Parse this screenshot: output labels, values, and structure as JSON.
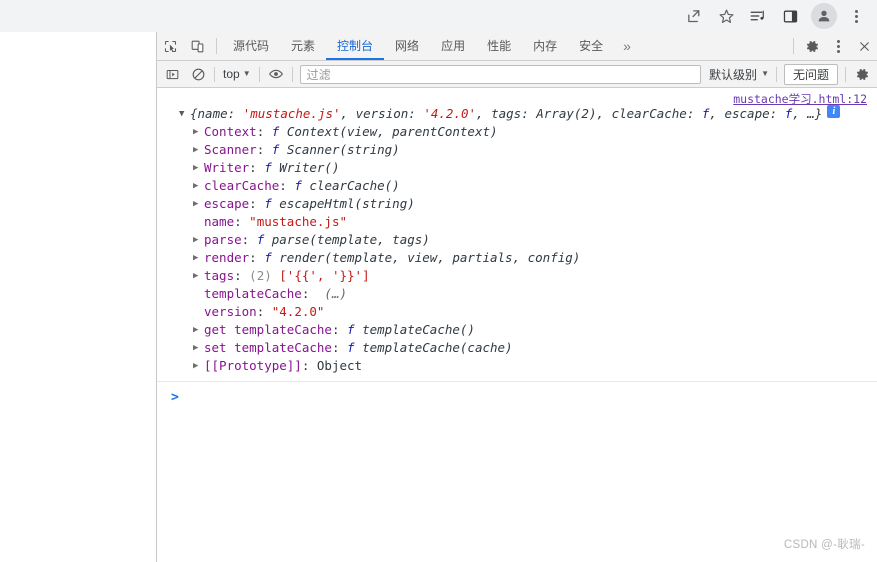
{
  "browser": {
    "actions": [
      {
        "name": "share-icon",
        "label": "Share"
      },
      {
        "name": "bookmark-star-icon",
        "label": "Bookmark this tab"
      },
      {
        "name": "media-playlist-icon",
        "label": "Media"
      },
      {
        "name": "side-panel-icon",
        "label": "Side panel"
      },
      {
        "name": "profile-avatar-icon",
        "label": "Profile"
      },
      {
        "name": "chrome-menu-icon",
        "label": "Customize and control Google Chrome"
      }
    ]
  },
  "devtools": {
    "inspect_icon": "inspect-element-icon",
    "device_icon": "device-toolbar-icon",
    "tabs": [
      {
        "label": "源代码",
        "active": false
      },
      {
        "label": "元素",
        "active": false
      },
      {
        "label": "控制台",
        "active": true
      },
      {
        "label": "网络",
        "active": false
      },
      {
        "label": "应用",
        "active": false
      },
      {
        "label": "性能",
        "active": false
      },
      {
        "label": "内存",
        "active": false
      },
      {
        "label": "安全",
        "active": false
      }
    ],
    "more_tabs": "»",
    "settings_icon": "gear-icon",
    "menu_icon": "kebab-menu-icon",
    "close_icon": "close-icon",
    "toolbar": {
      "sidebar_toggle": "console-sidebar-icon",
      "clear_console": "clear-console-icon",
      "context_value": "top",
      "eye_icon": "live-expression-eye-icon",
      "filter_placeholder": "过滤",
      "filter_value": "",
      "level_label": "默认级别",
      "issues_label": "无问题",
      "settings_icon": "gear-icon"
    }
  },
  "console": {
    "source_link": "mustache学习.html:12",
    "info_badge": "i",
    "header": {
      "open_brace": "{",
      "name_key": "name:",
      "name_val": "'mustache.js'",
      "sep1": ", ",
      "version_key": "version:",
      "version_val": "'4.2.0'",
      "sep2": ", ",
      "tags_key": "tags:",
      "tags_val": "Array(2)",
      "sep3": ", ",
      "clear_key": "clearCache:",
      "clear_val": "f",
      "sep4": ", ",
      "escape_key": "escape:",
      "escape_val": "f",
      "tail": ", …}"
    },
    "rows": [
      {
        "expandable": true,
        "key": "Context",
        "sep": ": ",
        "fn": "f",
        "sig": "Context(view, parentContext)",
        "style": "fn"
      },
      {
        "expandable": true,
        "key": "Scanner",
        "sep": ": ",
        "fn": "f",
        "sig": "Scanner(string)",
        "style": "fn"
      },
      {
        "expandable": true,
        "key": "Writer",
        "sep": ": ",
        "fn": "f",
        "sig": "Writer()",
        "style": "fn"
      },
      {
        "expandable": true,
        "key": "clearCache",
        "sep": ": ",
        "fn": "f",
        "sig": "clearCache()",
        "style": "fn"
      },
      {
        "expandable": true,
        "key": "escape",
        "sep": ": ",
        "fn": "f",
        "sig": "escapeHtml(string)",
        "style": "fn"
      },
      {
        "expandable": false,
        "key": "name",
        "sep": ": ",
        "fn": "",
        "sig": "\"mustache.js\"",
        "style": "string"
      },
      {
        "expandable": true,
        "key": "parse",
        "sep": ": ",
        "fn": "f",
        "sig": "parse(template, tags)",
        "style": "fn"
      },
      {
        "expandable": true,
        "key": "render",
        "sep": ": ",
        "fn": "f",
        "sig": "render(template, view, partials, config)",
        "style": "fn"
      },
      {
        "expandable": true,
        "key": "tags",
        "sep": ": ",
        "fn": "",
        "sig": "(2) ['{{', '}}']",
        "style": "array"
      },
      {
        "expandable": false,
        "key": "templateCache",
        "sep": ":  ",
        "fn": "",
        "sig": "(…)",
        "style": "preview"
      },
      {
        "expandable": false,
        "key": "version",
        "sep": ": ",
        "fn": "",
        "sig": "\"4.2.0\"",
        "style": "string"
      },
      {
        "expandable": true,
        "key": "get templateCache",
        "sep": ": ",
        "fn": "f",
        "sig": "templateCache()",
        "style": "fn"
      },
      {
        "expandable": true,
        "key": "set templateCache",
        "sep": ": ",
        "fn": "f",
        "sig": "templateCache(cache)",
        "style": "fn"
      },
      {
        "expandable": true,
        "key": "[[Prototype]]",
        "sep": ": ",
        "fn": "",
        "sig": "Object",
        "style": "proto"
      }
    ],
    "prompt": ">"
  },
  "watermark": "CSDN @-耿瑞-",
  "colors": {
    "accent": "#1a73e8",
    "tab_active": "#1967d2",
    "key": "#881391",
    "string": "#c41a16",
    "function": "#1a1aa6",
    "link": "#6a3ab2",
    "chrome_bg": "#f1f3f4",
    "devtools_bg": "#f3f3f3"
  }
}
